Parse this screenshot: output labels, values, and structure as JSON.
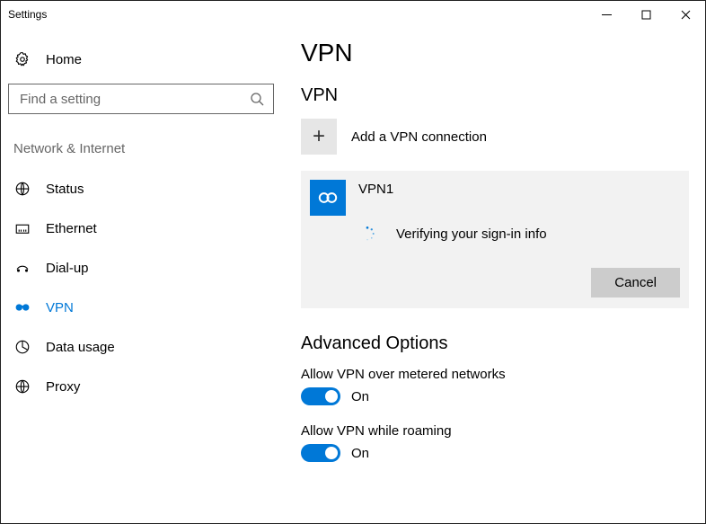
{
  "window": {
    "title": "Settings"
  },
  "sidebar": {
    "home_label": "Home",
    "search_placeholder": "Find a setting",
    "section_header": "Network & Internet",
    "items": [
      {
        "label": "Status",
        "icon": "status-icon",
        "active": false
      },
      {
        "label": "Ethernet",
        "icon": "ethernet-icon",
        "active": false
      },
      {
        "label": "Dial-up",
        "icon": "dialup-icon",
        "active": false
      },
      {
        "label": "VPN",
        "icon": "vpn-icon",
        "active": true
      },
      {
        "label": "Data usage",
        "icon": "datausage-icon",
        "active": false
      },
      {
        "label": "Proxy",
        "icon": "proxy-icon",
        "active": false
      }
    ]
  },
  "main": {
    "page_title": "VPN",
    "section_title": "VPN",
    "add_label": "Add a VPN connection",
    "connection": {
      "name": "VPN1",
      "status": "Verifying your sign-in info",
      "cancel_label": "Cancel"
    },
    "advanced_title": "Advanced Options",
    "options": [
      {
        "label": "Allow VPN over metered networks",
        "state": "On",
        "on": true
      },
      {
        "label": "Allow VPN while roaming",
        "state": "On",
        "on": true
      }
    ]
  }
}
